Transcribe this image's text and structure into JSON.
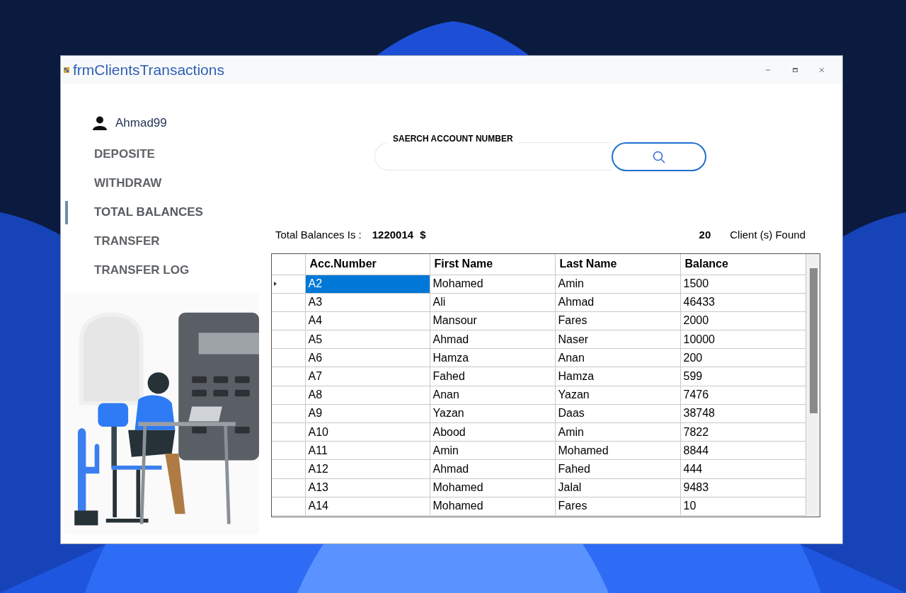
{
  "window": {
    "title": "frmClientsTransactions"
  },
  "user": {
    "name": "Ahmad99"
  },
  "menu": [
    {
      "label": "DEPOSITE",
      "selected": false
    },
    {
      "label": "WITHDRAW",
      "selected": false
    },
    {
      "label": "TOTAL BALANCES",
      "selected": true
    },
    {
      "label": "TRANSFER",
      "selected": false
    },
    {
      "label": "TRANSFER LOG",
      "selected": false
    }
  ],
  "search": {
    "label": "SAERCH ACCOUNT NUMBER"
  },
  "summary": {
    "total_label": "Total Balances Is :",
    "total_value": "1220014",
    "currency": "$",
    "count": "20",
    "count_label": "Client (s) Found"
  },
  "table": {
    "columns": [
      "Acc.Number",
      "First Name",
      "Last Name",
      "Balance"
    ],
    "rows": [
      {
        "cells": [
          "A2",
          "Mohamed",
          "Amin",
          "1500"
        ],
        "selected": true
      },
      {
        "cells": [
          "A3",
          "Ali",
          "Ahmad",
          "46433"
        ],
        "selected": false
      },
      {
        "cells": [
          "A4",
          "Mansour",
          "Fares",
          "2000"
        ],
        "selected": false
      },
      {
        "cells": [
          "A5",
          "Ahmad",
          "Naser",
          "10000"
        ],
        "selected": false
      },
      {
        "cells": [
          "A6",
          "Hamza",
          "Anan",
          "200"
        ],
        "selected": false
      },
      {
        "cells": [
          "A7",
          "Fahed",
          "Hamza",
          "599"
        ],
        "selected": false
      },
      {
        "cells": [
          "A8",
          "Anan",
          "Yazan",
          "7476"
        ],
        "selected": false
      },
      {
        "cells": [
          "A9",
          "Yazan",
          "Daas",
          "38748"
        ],
        "selected": false
      },
      {
        "cells": [
          "A10",
          "Abood",
          "Amin",
          "7822"
        ],
        "selected": false
      },
      {
        "cells": [
          "A11",
          "Amin",
          "Mohamed",
          "8844"
        ],
        "selected": false
      },
      {
        "cells": [
          "A12",
          "Ahmad",
          "Fahed",
          "444"
        ],
        "selected": false
      },
      {
        "cells": [
          "A13",
          "Mohamed",
          "Jalal",
          "9483"
        ],
        "selected": false
      },
      {
        "cells": [
          "A14",
          "Mohamed",
          "Fares",
          "10"
        ],
        "selected": false
      }
    ]
  }
}
